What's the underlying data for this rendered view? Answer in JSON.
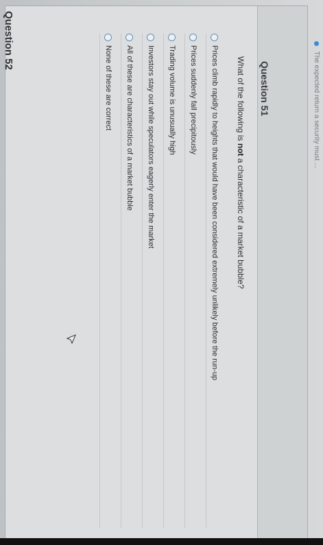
{
  "previous_question_fragment": "The expected return a security must ... ",
  "question": {
    "title": "Question 51",
    "stem_prefix": "What of the following is ",
    "stem_emphasis": "not",
    "stem_suffix": " a characteristic of a market bubble?",
    "options": [
      "Prices climb rapidly to heights that would have been considered extremely unlikely before the run-up",
      "Prices suddenly fall precipitously",
      "Trading volume is unusually high",
      "Investors stay out while speculators eagerly enter the market",
      "All of these are characteristics of a market bubble",
      "None of these are correct"
    ],
    "selected_index": null
  },
  "next_question": {
    "title": "Question 52"
  },
  "colors": {
    "radio_border": "#6a8fb8",
    "accent_dot": "#3a8ad6"
  },
  "icons": [
    "arrow-cursor-icon",
    "bullet-dot-icon",
    "radio-button-icon"
  ]
}
